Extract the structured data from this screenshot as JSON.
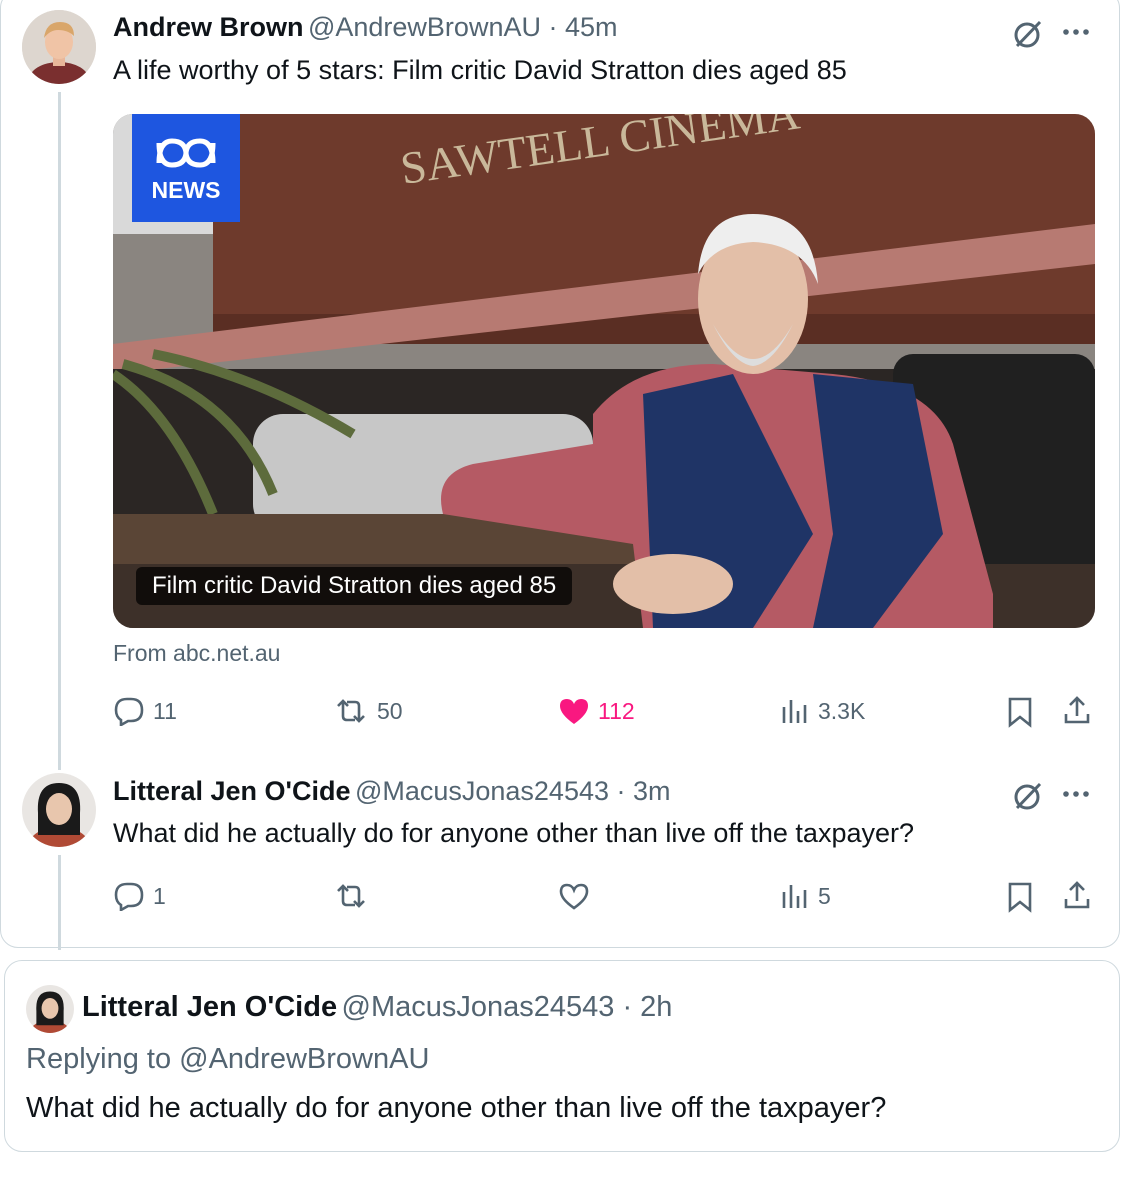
{
  "main_tweet": {
    "author_name": "Andrew Brown",
    "handle_time": "@AndrewBrownAU · 45m",
    "text": "A life worthy of 5 stars: Film critic David Stratton dies aged 85",
    "media": {
      "logo_text": "NEWS",
      "sign_text": "SAWTELL CINEMA",
      "caption": "Film critic David Stratton dies aged 85"
    },
    "source": "From abc.net.au",
    "actions": {
      "replies": "11",
      "reposts": "50",
      "likes": "112",
      "views": "3.3K"
    }
  },
  "reply_tweet": {
    "author_name": "Litteral Jen O'Cide",
    "handle_time": "@MacusJonas24543 · 3m",
    "text": "What did he actually do for anyone other than live off the taxpayer?",
    "actions": {
      "replies": "1",
      "reposts": "",
      "likes": "",
      "views": "5"
    }
  },
  "quoted_tweet": {
    "author_name": "Litteral Jen O'Cide",
    "handle_time": "@MacusJonas24543 · 2h",
    "replying_to": "Replying to @AndrewBrownAU",
    "text": "What did he actually do for anyone other than live off the taxpayer?"
  },
  "colors": {
    "accent_like": "#f91880",
    "secondary_text": "#536471",
    "border": "#cfd9de",
    "link": "#1d9bf0"
  }
}
